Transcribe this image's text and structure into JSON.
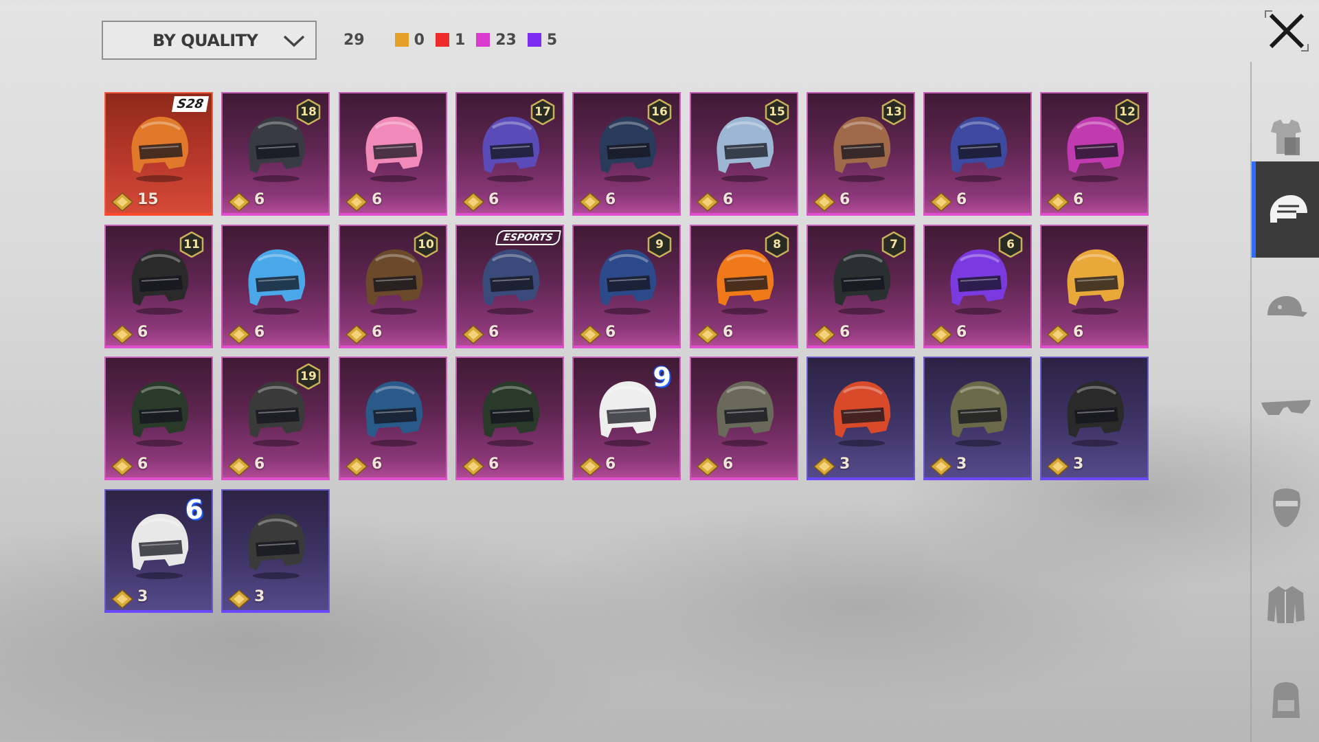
{
  "toolbar": {
    "sort_label": "BY QUALITY",
    "total_count": "29",
    "quality_counts": [
      {
        "color": "#e5a02a",
        "count": "0"
      },
      {
        "color": "#ee2b2b",
        "count": "1"
      },
      {
        "color": "#d93bcf",
        "count": "23"
      },
      {
        "color": "#7b2cf0",
        "count": "5"
      }
    ]
  },
  "sidebar": {
    "items": [
      {
        "name": "outfit-icon",
        "active": false
      },
      {
        "name": "helmet-icon",
        "active": true
      },
      {
        "name": "cap-icon",
        "active": false
      },
      {
        "name": "glasses-icon",
        "active": false
      },
      {
        "name": "mask-icon",
        "active": false
      },
      {
        "name": "jacket-icon",
        "active": false
      },
      {
        "name": "backpack-icon",
        "active": false
      }
    ]
  },
  "items": [
    {
      "quality": "red",
      "price": "15",
      "tag": "S28",
      "tag_type": "season",
      "helmet": "#e07a2a"
    },
    {
      "quality": "pink",
      "price": "6",
      "tag": "18",
      "tag_type": "level",
      "helmet": "#3a3a44"
    },
    {
      "quality": "pink",
      "price": "6",
      "tag": "",
      "tag_type": "",
      "helmet": "#f08ab8"
    },
    {
      "quality": "pink",
      "price": "6",
      "tag": "17",
      "tag_type": "level",
      "helmet": "#5b4bb8"
    },
    {
      "quality": "pink",
      "price": "6",
      "tag": "16",
      "tag_type": "level",
      "helmet": "#2a3a5a"
    },
    {
      "quality": "pink",
      "price": "6",
      "tag": "15",
      "tag_type": "level",
      "helmet": "#9cb6d4"
    },
    {
      "quality": "pink",
      "price": "6",
      "tag": "13",
      "tag_type": "level",
      "helmet": "#a0694a"
    },
    {
      "quality": "pink",
      "price": "6",
      "tag": "",
      "tag_type": "",
      "helmet": "#3d4aa0"
    },
    {
      "quality": "pink",
      "price": "6",
      "tag": "12",
      "tag_type": "level",
      "helmet": "#c03bb0"
    },
    {
      "quality": "pink",
      "price": "6",
      "tag": "11",
      "tag_type": "level",
      "helmet": "#2a2a2a"
    },
    {
      "quality": "pink",
      "price": "6",
      "tag": "",
      "tag_type": "",
      "helmet": "#4aa8e8"
    },
    {
      "quality": "pink",
      "price": "6",
      "tag": "10",
      "tag_type": "level",
      "helmet": "#6a4a2a"
    },
    {
      "quality": "pink",
      "price": "6",
      "tag": "ESPORTS",
      "tag_type": "esports",
      "helmet": "#3a4a7a"
    },
    {
      "quality": "pink",
      "price": "6",
      "tag": "9",
      "tag_type": "level",
      "helmet": "#2c4a8a"
    },
    {
      "quality": "pink",
      "price": "6",
      "tag": "8",
      "tag_type": "level",
      "helmet": "#f07a1a"
    },
    {
      "quality": "pink",
      "price": "6",
      "tag": "7",
      "tag_type": "level",
      "helmet": "#2a3030"
    },
    {
      "quality": "pink",
      "price": "6",
      "tag": "6",
      "tag_type": "level",
      "helmet": "#7a3ae0"
    },
    {
      "quality": "pink",
      "price": "6",
      "tag": "",
      "tag_type": "",
      "helmet": "#e8a83a"
    },
    {
      "quality": "pink",
      "price": "6",
      "tag": "",
      "tag_type": "",
      "helmet": "#2a3a2a"
    },
    {
      "quality": "pink",
      "price": "6",
      "tag": "19",
      "tag_type": "level",
      "helmet": "#3a3a3a"
    },
    {
      "quality": "pink",
      "price": "6",
      "tag": "",
      "tag_type": "",
      "helmet": "#2a5a8a"
    },
    {
      "quality": "pink",
      "price": "6",
      "tag": "",
      "tag_type": "",
      "helmet": "#2a3a2a"
    },
    {
      "quality": "pink",
      "price": "6",
      "tag": "9",
      "tag_type": "bignum",
      "helmet": "#eeeeee"
    },
    {
      "quality": "pink",
      "price": "6",
      "tag": "",
      "tag_type": "",
      "helmet": "#6a6a5a"
    },
    {
      "quality": "purple",
      "price": "3",
      "tag": "",
      "tag_type": "",
      "helmet": "#d84a2a"
    },
    {
      "quality": "purple",
      "price": "3",
      "tag": "",
      "tag_type": "",
      "helmet": "#6a6a4a"
    },
    {
      "quality": "purple",
      "price": "3",
      "tag": "",
      "tag_type": "",
      "helmet": "#2a2a2a"
    },
    {
      "quality": "purple",
      "price": "3",
      "tag": "6",
      "tag_type": "bignum",
      "helmet": "#e8e8e8"
    },
    {
      "quality": "purple",
      "price": "3",
      "tag": "",
      "tag_type": "",
      "helmet": "#3a3a3a"
    }
  ]
}
